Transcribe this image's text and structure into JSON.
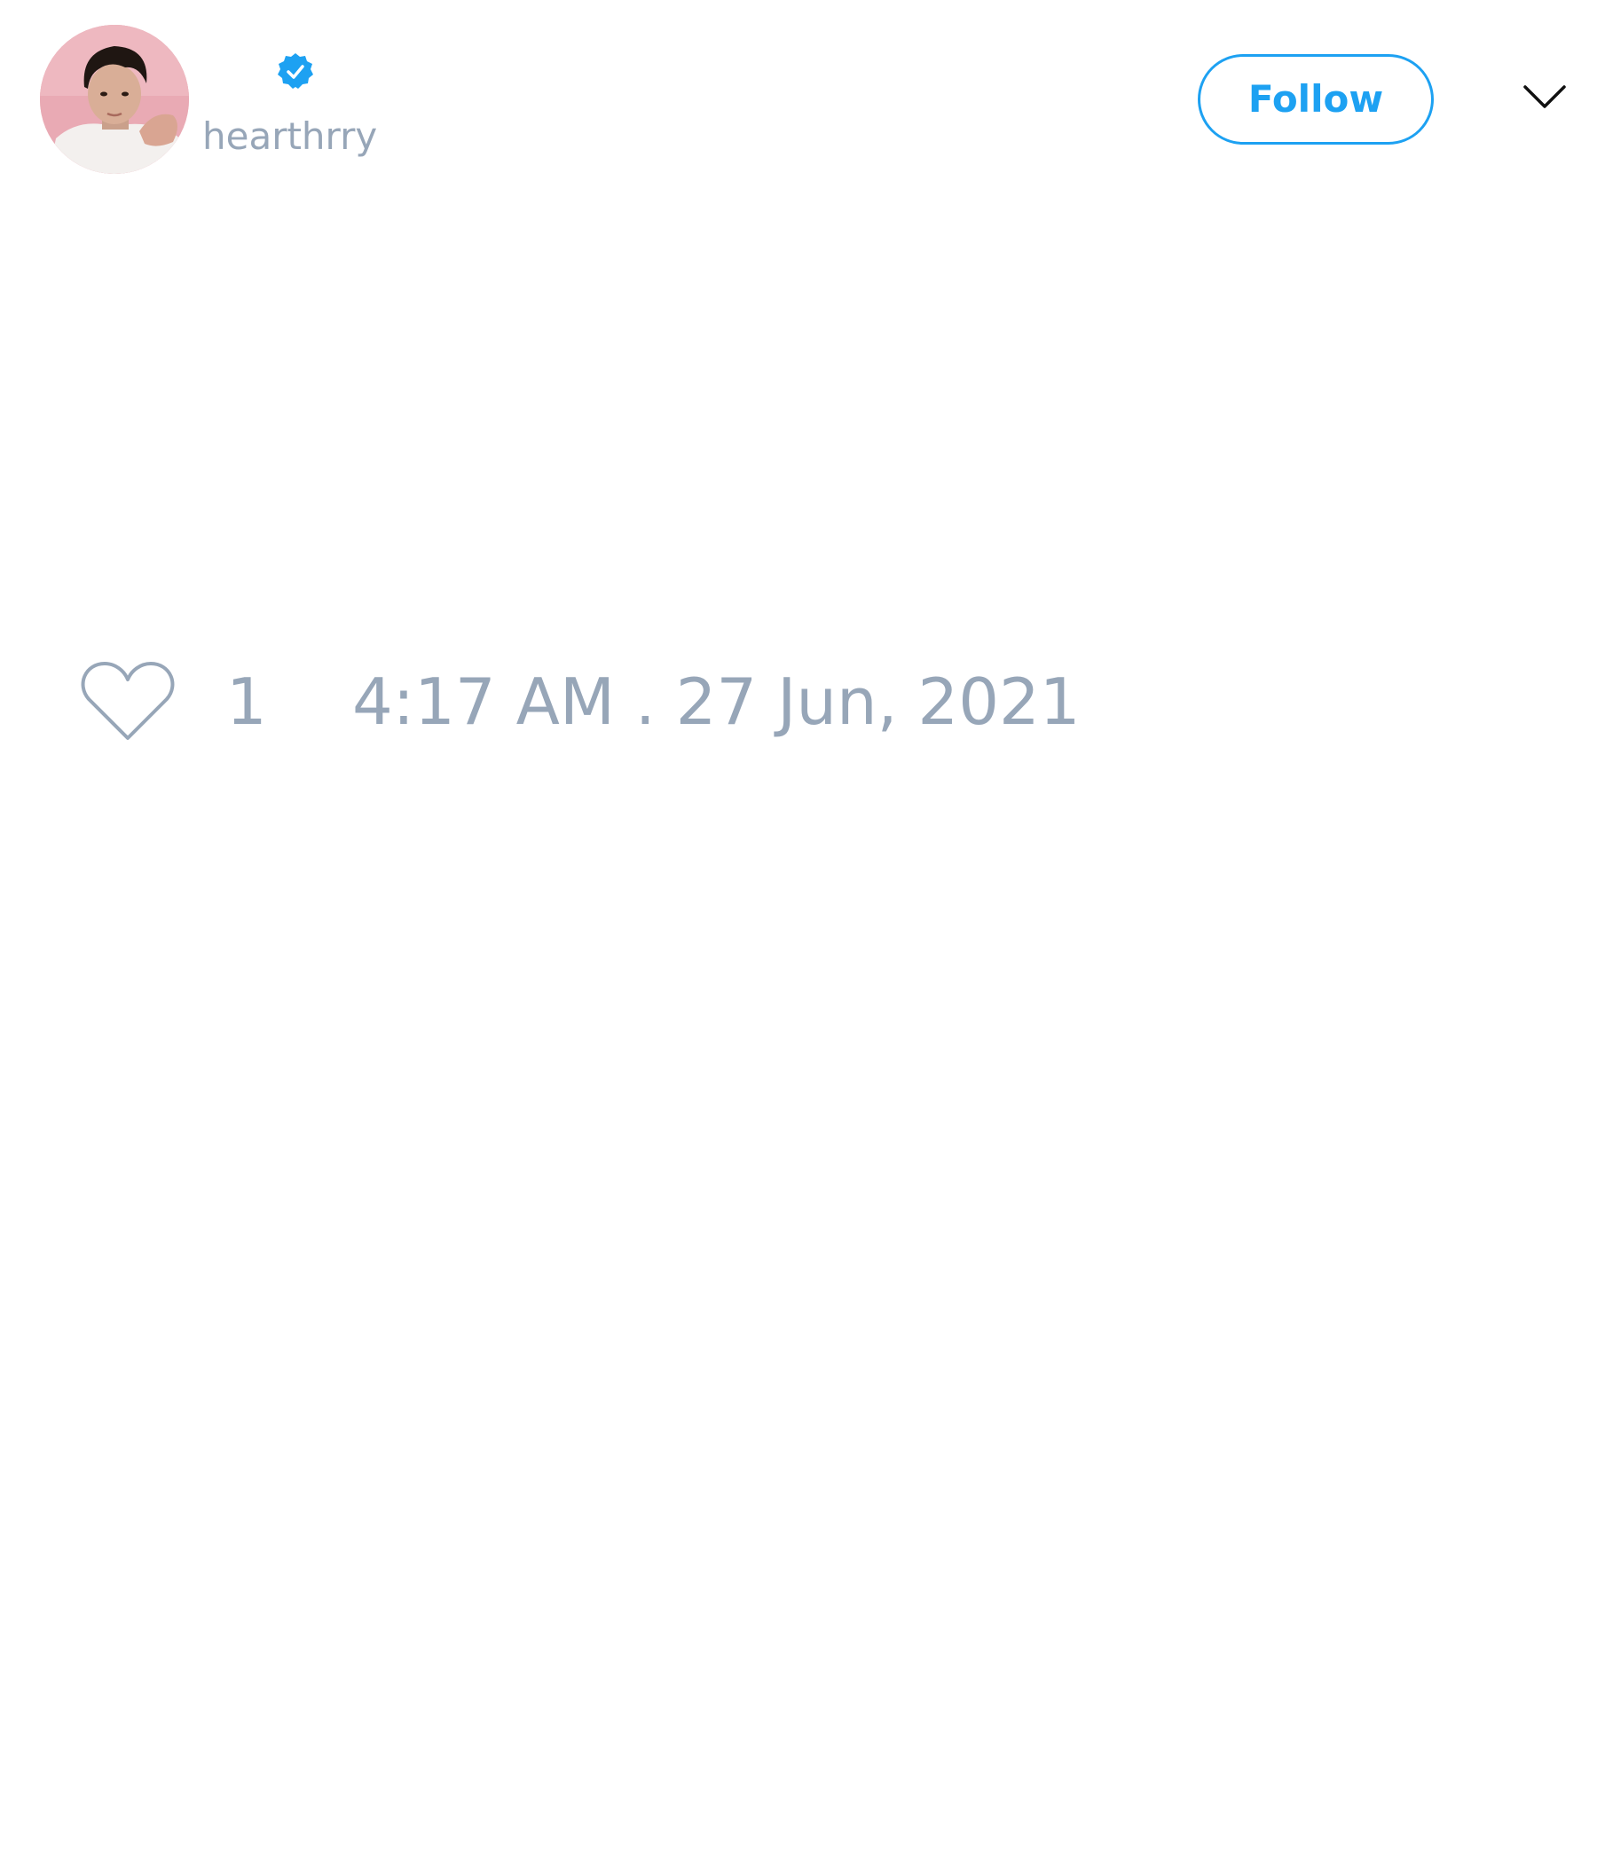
{
  "header": {
    "handle": "hearthrry",
    "follow_label": "Follow",
    "avatar_icon": "user-avatar-photo",
    "verified_icon": "verified-badge-icon",
    "menu_icon": "chevron-down-icon"
  },
  "meta": {
    "like_count": "1",
    "timestamp": "4:17 AM . 27 Jun, 2021",
    "like_icon": "heart-icon"
  },
  "colors": {
    "accent": "#1da1f2",
    "muted_text": "#97a6b8",
    "background": "#ffffff"
  }
}
